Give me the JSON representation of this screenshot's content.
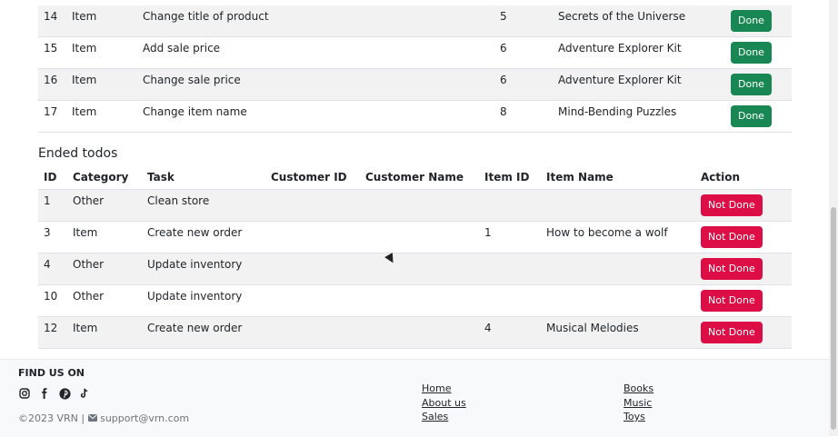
{
  "active_todos": [
    {
      "id": "14",
      "category": "Item",
      "task": "Change title of product",
      "customer_id": "",
      "customer_name": "",
      "item_id": "5",
      "item_name": "Secrets of the Universe",
      "action": "Done"
    },
    {
      "id": "15",
      "category": "Item",
      "task": "Add sale price",
      "customer_id": "",
      "customer_name": "",
      "item_id": "6",
      "item_name": "Adventure Explorer Kit",
      "action": "Done"
    },
    {
      "id": "16",
      "category": "Item",
      "task": "Change sale price",
      "customer_id": "",
      "customer_name": "",
      "item_id": "6",
      "item_name": "Adventure Explorer Kit",
      "action": "Done"
    },
    {
      "id": "17",
      "category": "Item",
      "task": "Change item name",
      "customer_id": "",
      "customer_name": "",
      "item_id": "8",
      "item_name": "Mind-Bending Puzzles",
      "action": "Done"
    }
  ],
  "ended": {
    "title": "Ended todos",
    "headers": [
      "ID",
      "Category",
      "Task",
      "Customer ID",
      "Customer Name",
      "Item ID",
      "Item Name",
      "Action"
    ],
    "rows": [
      {
        "id": "1",
        "category": "Other",
        "task": "Clean store",
        "customer_id": "",
        "customer_name": "",
        "item_id": "",
        "item_name": "",
        "action": "Not Done"
      },
      {
        "id": "3",
        "category": "Item",
        "task": "Create new order",
        "customer_id": "",
        "customer_name": "",
        "item_id": "1",
        "item_name": "How to become a wolf",
        "action": "Not Done"
      },
      {
        "id": "4",
        "category": "Other",
        "task": "Update inventory",
        "customer_id": "",
        "customer_name": "",
        "item_id": "",
        "item_name": "",
        "action": "Not Done"
      },
      {
        "id": "10",
        "category": "Other",
        "task": "Update inventory",
        "customer_id": "",
        "customer_name": "",
        "item_id": "",
        "item_name": "",
        "action": "Not Done"
      },
      {
        "id": "12",
        "category": "Item",
        "task": "Create new order",
        "customer_id": "",
        "customer_name": "",
        "item_id": "4",
        "item_name": "Musical Melodies",
        "action": "Not Done"
      }
    ]
  },
  "footer": {
    "find_us": "FIND US ON",
    "social_icons": [
      "instagram-icon",
      "facebook-icon",
      "pinterest-icon",
      "tiktok-icon"
    ],
    "copyright": "©2023 VRN |",
    "email": "support@vrn.com",
    "links_col1": [
      "Home",
      "About us",
      "Sales"
    ],
    "links_col2": [
      "Books",
      "Music",
      "Toys"
    ]
  },
  "colors": {
    "done": "#198754",
    "not_done": "#dc0e45"
  }
}
